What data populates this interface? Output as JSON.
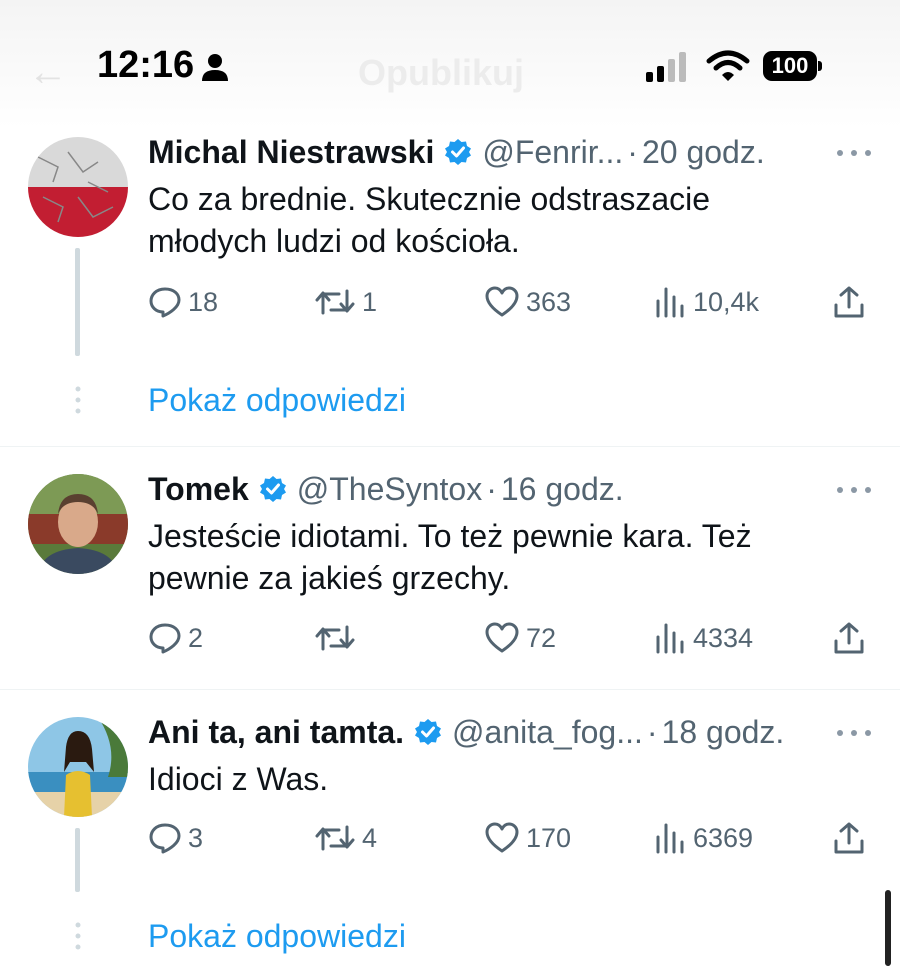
{
  "status_bar": {
    "time": "12:16",
    "battery": "100",
    "icons": [
      "person-icon",
      "signal-icon",
      "wifi-icon",
      "battery-icon"
    ]
  },
  "header": {
    "title": "Opublikuj"
  },
  "colors": {
    "accent": "#1d9bf0",
    "secondary_text": "#536471",
    "primary_text": "#0f1419",
    "divider": "#eff3f4"
  },
  "tweets": [
    {
      "name": "Michal Niestrawski",
      "handle": "@Fenrir...",
      "time": "20 godz.",
      "text": "Co za brednie. Skutecznie odstraszacie młodych ludzi od kościoła.",
      "replies": "18",
      "retweets": "1",
      "likes": "363",
      "views": "10,4k",
      "show_replies": "Pokaż odpowiedzi"
    },
    {
      "name": "Tomek",
      "handle": "@TheSyntox",
      "time": "16 godz.",
      "text": "Jesteście idiotami. To też pewnie kara. Też pewnie za jakieś grzechy.",
      "replies": "2",
      "retweets": "",
      "likes": "72",
      "views": "4334"
    },
    {
      "name": "Ani ta, ani tamta.",
      "handle": "@anita_fog...",
      "time": "18 godz.",
      "text": "Idioci z Was.",
      "replies": "3",
      "retweets": "4",
      "likes": "170",
      "views": "6369",
      "show_replies": "Pokaż odpowiedzi"
    }
  ],
  "separator": "·"
}
